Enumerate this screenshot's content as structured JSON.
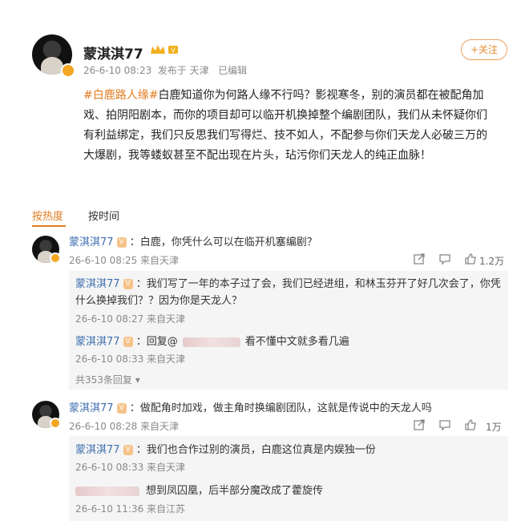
{
  "post": {
    "author": "蒙淇淇77",
    "meta": "26-6-10 08:23  发布于 天津   已编辑",
    "follow_label": "+关注",
    "hashtag": "#白鹿路人缘#",
    "body_lines": [
      "白鹿知道你为何路人缘不行吗？影视寒冬，别的演员都在被配角加",
      "戏、拍阴阳剧本，而你的项目却可以临开机换掉整个编剧团队，我们从未怀疑你们",
      "有利益绑定，我们只反思我们写得烂、技不如人，不配参与你们天龙人必破三万的",
      "大爆剧，我等蝼蚁甚至不配出现在片头，玷污你们天龙人的纯正血脉！"
    ]
  },
  "sort": {
    "hot_label": "按热度",
    "time_label": "按时间"
  },
  "comments": [
    {
      "author": "蒙淇淇77",
      "text": "：白鹿，你凭什么可以在临开机塞编剧？",
      "meta": "26-6-10 08:25 来自天津",
      "likes": "1.2万",
      "replies": [
        {
          "author": "蒙淇淇77",
          "text": "：我们写了一年的本子过了会，我们已经进组，和林玉芬开了好几次会了，你凭",
          "text2": "什么换掉我们？？因为你是天龙人？",
          "meta": "26-6-10 08:27 来自天津"
        },
        {
          "author": "蒙淇淇77",
          "text": "：回复@",
          "text2": "看不懂中文就多看几遍",
          "meta": "26-6-10 08:33 来自天津"
        }
      ],
      "more": "共353条回复"
    },
    {
      "author": "蒙淇淇77",
      "text": "：做配角时加戏，做主角时换编剧团队，这就是传说中的天龙人吗",
      "meta": "26-6-10 08:28 来自天津",
      "likes": "1万",
      "replies": [
        {
          "author": "蒙淇淇77",
          "text": "：我们也合作过别的演员，白鹿这位真是内娱独一份",
          "meta": "26-6-10 08:33 来自天津"
        },
        {
          "author": "",
          "text": "想到凤囚凰，后半部分魔改成了藿旋传",
          "meta": "26-6-10 11:36 来自江苏"
        }
      ]
    }
  ],
  "colors": {
    "accent": "#e27b1f",
    "link": "#3f6fb0",
    "meta": "#8a8a8a",
    "hashtag": "#e27b1f"
  }
}
